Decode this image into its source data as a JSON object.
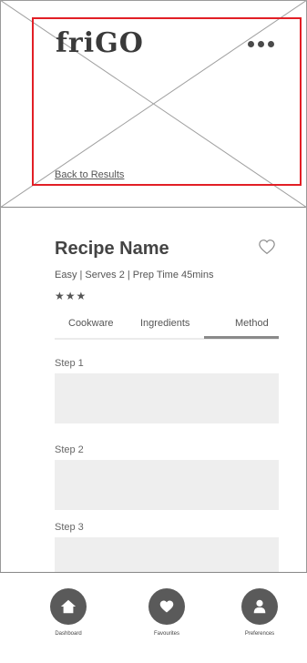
{
  "app": {
    "logo_text": "friGO"
  },
  "hero": {
    "back_link": "Back to Results"
  },
  "recipe": {
    "name": "Recipe Name",
    "meta": "Easy | Serves 2 | Prep Time 45mins",
    "stars": "★★★"
  },
  "tabs": [
    {
      "label": "Cookware"
    },
    {
      "label": "Ingredients"
    },
    {
      "label": "Method",
      "active": true
    }
  ],
  "steps": [
    {
      "label": "Step 1"
    },
    {
      "label": "Step 2"
    },
    {
      "label": "Step 3"
    }
  ],
  "bottom_nav": [
    {
      "label": "Dashboard",
      "icon": "home-icon"
    },
    {
      "label": "Favourites",
      "icon": "heart-icon"
    },
    {
      "label": "Preferences",
      "icon": "user-icon"
    }
  ],
  "colors": {
    "accent_border": "#e21f26",
    "nav_circle": "#5a5a5a",
    "placeholder": "#eeeeee"
  }
}
